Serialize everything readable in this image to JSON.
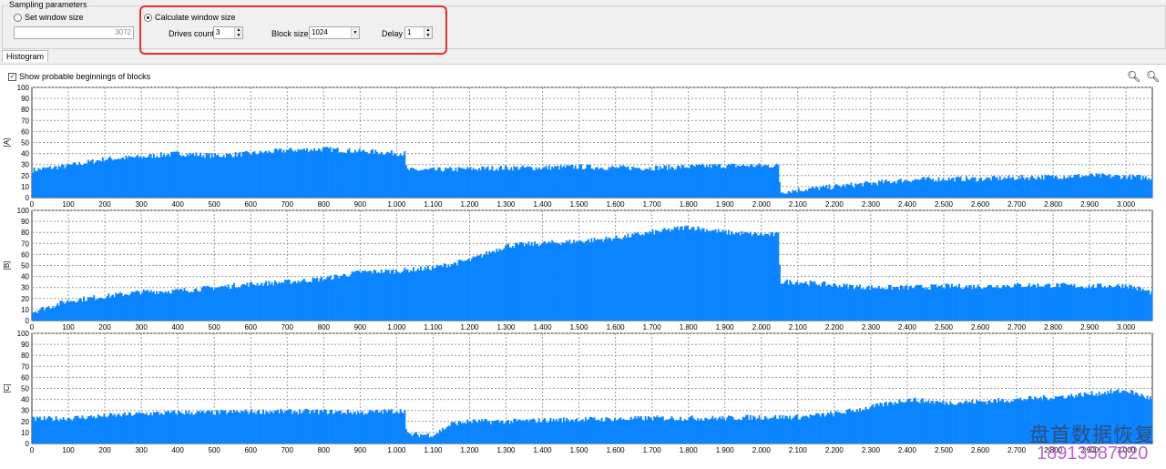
{
  "sampling": {
    "title": "Sampling parameters",
    "set_window_label": "Set window size",
    "window_size_value": "3072",
    "calc_window_label": "Calculate window size",
    "drives_label": "Drives count",
    "drives_value": "3",
    "block_label": "Block size",
    "block_value": "1024",
    "delay_label": "Delay",
    "delay_value": "1"
  },
  "tabs": [
    {
      "label": "Histogram"
    }
  ],
  "show_beginnings_label": "Show probable beginnings of blocks",
  "show_beginnings_checked": true,
  "zoom_icons": [
    "zoom-out-icon",
    "zoom-in-icon"
  ],
  "watermark": {
    "text": "盘首数据恢复",
    "phone": "18913587620"
  },
  "chart_data": [
    {
      "type": "area",
      "ylabel": "[A]",
      "ylim": [
        0,
        100
      ],
      "xlim": [
        0,
        3072
      ],
      "grid": true,
      "color": "#0a84ff",
      "x": [
        0,
        100,
        200,
        300,
        400,
        500,
        600,
        700,
        800,
        900,
        1020,
        1025,
        1100,
        1200,
        1300,
        1400,
        1500,
        1600,
        1700,
        1800,
        1900,
        2000,
        2045,
        2050,
        2100,
        2200,
        2300,
        2400,
        2500,
        2600,
        2700,
        2800,
        2900,
        3000,
        3072
      ],
      "y": [
        25,
        29,
        35,
        37,
        40,
        38,
        40,
        43,
        44,
        42,
        40,
        25,
        25,
        26,
        27,
        27,
        28,
        27,
        27,
        28,
        29,
        29,
        29,
        5,
        7,
        10,
        13,
        16,
        17,
        17,
        18,
        19,
        20,
        19,
        18
      ]
    },
    {
      "type": "area",
      "ylabel": "[B]",
      "ylim": [
        0,
        100
      ],
      "xlim": [
        0,
        3072
      ],
      "grid": true,
      "color": "#0a84ff",
      "x": [
        0,
        100,
        200,
        300,
        400,
        500,
        600,
        700,
        800,
        900,
        1000,
        1100,
        1200,
        1300,
        1400,
        1500,
        1600,
        1700,
        1800,
        1900,
        2000,
        2045,
        2050,
        2100,
        2200,
        2300,
        2400,
        2500,
        2600,
        2700,
        2800,
        2900,
        3000,
        3072
      ],
      "y": [
        8,
        18,
        22,
        26,
        27,
        30,
        33,
        35,
        38,
        44,
        45,
        48,
        55,
        68,
        70,
        72,
        75,
        80,
        85,
        80,
        78,
        78,
        35,
        35,
        32,
        30,
        30,
        31,
        31,
        32,
        32,
        31,
        32,
        25
      ]
    },
    {
      "type": "area",
      "ylabel": "[C]",
      "ylim": [
        0,
        100
      ],
      "xlim": [
        0,
        3072
      ],
      "grid": true,
      "color": "#0a84ff",
      "x": [
        0,
        100,
        200,
        300,
        400,
        500,
        600,
        700,
        800,
        900,
        1020,
        1025,
        1100,
        1150,
        1200,
        1300,
        1400,
        1500,
        1600,
        1700,
        1800,
        1900,
        2000,
        2100,
        2200,
        2300,
        2400,
        2500,
        2600,
        2700,
        2800,
        2900,
        3000,
        3072
      ],
      "y": [
        22,
        23,
        25,
        27,
        28,
        28,
        29,
        29,
        29,
        28,
        30,
        8,
        8,
        18,
        20,
        20,
        21,
        22,
        22,
        23,
        23,
        23,
        24,
        24,
        27,
        33,
        40,
        37,
        38,
        40,
        42,
        45,
        48,
        40
      ]
    }
  ],
  "x_ticks": [
    "0",
    "100",
    "200",
    "300",
    "400",
    "500",
    "600",
    "700",
    "800",
    "900",
    "1.000",
    "1.100",
    "1.200",
    "1.300",
    "1.400",
    "1.500",
    "1.600",
    "1.700",
    "1.800",
    "1.900",
    "2.000",
    "2.100",
    "2.200",
    "2.300",
    "2.400",
    "2.500",
    "2.600",
    "2.700",
    "2.800",
    "2.900",
    "3.000"
  ],
  "y_ticks": [
    "0",
    "10",
    "20",
    "30",
    "40",
    "50",
    "60",
    "70",
    "80",
    "90",
    "100"
  ]
}
